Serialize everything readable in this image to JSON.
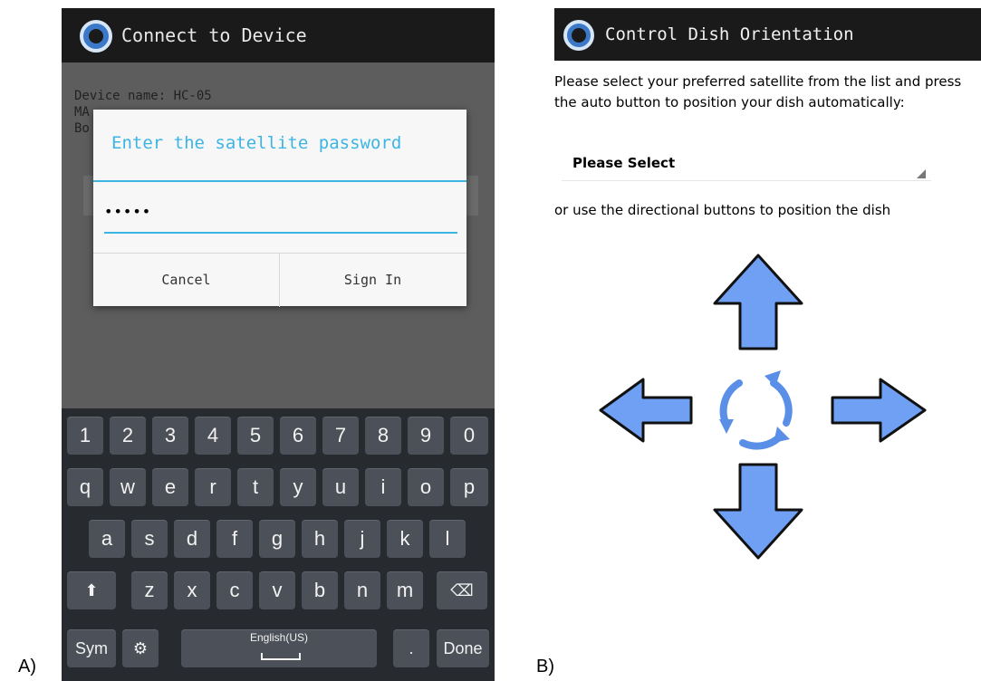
{
  "labels": {
    "a": "A)",
    "b": "B)"
  },
  "panel_a": {
    "title": "Connect to Device",
    "device_info": [
      "Device name: HC-05",
      "MA",
      "Bo"
    ],
    "dialog": {
      "title": "Enter the satellite password",
      "password_value": "•••••",
      "cancel": "Cancel",
      "sign_in": "Sign In"
    },
    "keyboard": {
      "row1": [
        "1",
        "2",
        "3",
        "4",
        "5",
        "6",
        "7",
        "8",
        "9",
        "0"
      ],
      "row2": [
        "q",
        "w",
        "e",
        "r",
        "t",
        "y",
        "u",
        "i",
        "o",
        "p"
      ],
      "row3": [
        "a",
        "s",
        "d",
        "f",
        "g",
        "h",
        "j",
        "k",
        "l"
      ],
      "row4": [
        "z",
        "x",
        "c",
        "v",
        "b",
        "n",
        "m"
      ],
      "shift": "⬆",
      "backspace": "⌫",
      "sym": "Sym",
      "settings": "⚙",
      "space": "English(US)",
      "period": ".",
      "done": "Done"
    }
  },
  "panel_b": {
    "title": "Control Dish Orientation",
    "instructions": "Please select your preferred satellite from the list and press the auto button to position your dish automatically:",
    "select_value": "Please Select",
    "instructions2": "or use the directional buttons to position the dish"
  },
  "colors": {
    "accent": "#3cb4e4",
    "arrow_fill": "#6fa0f3",
    "titlebar": "#1a1a1a"
  }
}
